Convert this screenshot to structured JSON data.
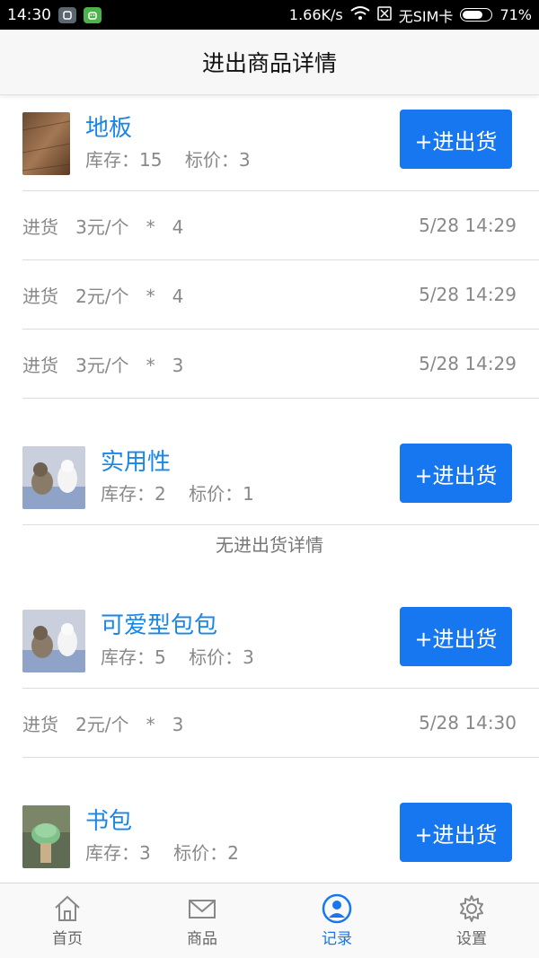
{
  "status_bar": {
    "time": "14:30",
    "speed": "1.66K/s",
    "sim": "无SIM卡",
    "battery": "71%",
    "battery_level": 0.71
  },
  "header": {
    "title": "进出商品详情"
  },
  "products": [
    {
      "name": "地板",
      "meta": "库存：15    标价：3",
      "button": "+进出货",
      "records": [
        {
          "desc": "进货   3元/个   *   4",
          "time": "5/28 14:29"
        },
        {
          "desc": "进货   2元/个   *   4",
          "time": "5/28 14:29"
        },
        {
          "desc": "进货   3元/个   *   3",
          "time": "5/28 14:29"
        }
      ]
    },
    {
      "name": "实用性",
      "meta": "库存：2    标价：1",
      "button": "+进出货",
      "empty_text": "无进出货详情"
    },
    {
      "name": "可爱型包包",
      "meta": "库存：5    标价：3",
      "button": "+进出货",
      "records": [
        {
          "desc": "进货   2元/个   *   3",
          "time": "5/28 14:30"
        }
      ]
    },
    {
      "name": "书包",
      "meta": "库存：3    标价：2",
      "button": "+进出货"
    }
  ],
  "nav": {
    "items": [
      {
        "label": "首页",
        "icon": "home-icon"
      },
      {
        "label": "商品",
        "icon": "mail-icon"
      },
      {
        "label": "记录",
        "icon": "user-icon"
      },
      {
        "label": "设置",
        "icon": "gear-icon"
      }
    ],
    "active_index": 2,
    "active_color": "#1677f0",
    "button_color": "#1677f0",
    "name_color": "#1a86e6"
  }
}
